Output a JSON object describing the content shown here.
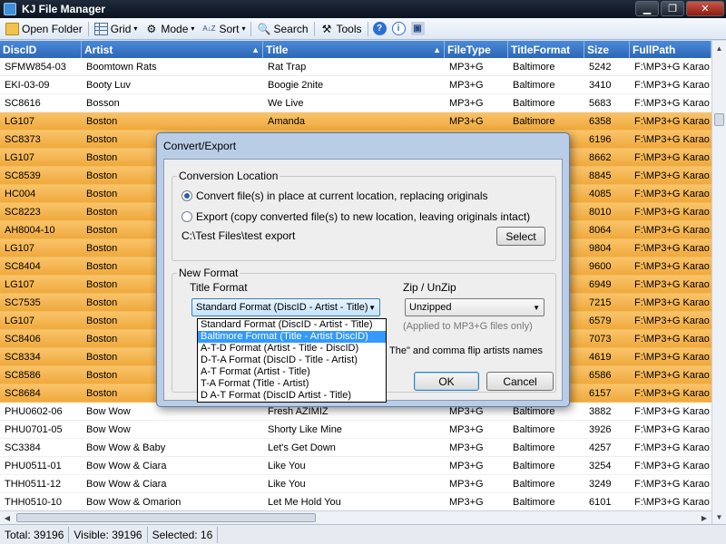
{
  "window": {
    "title": "KJ File Manager",
    "min": "▁",
    "max": "❐",
    "close": "✕"
  },
  "toolbar": {
    "open_folder": "Open Folder",
    "grid": "Grid",
    "mode": "Mode",
    "sort": "Sort",
    "search": "Search",
    "tools": "Tools",
    "help_glyph": "?",
    "info_glyph": "i",
    "sort_glyph": "A↓Z",
    "search_glyph": "🔍",
    "tools_glyph": "⚒",
    "caret": "▾"
  },
  "grid": {
    "columns": [
      "DiscID",
      "Artist",
      "Title",
      "FileType",
      "TitleFormat",
      "Size",
      "FullPath"
    ],
    "sort_arrow": "▲",
    "rows": [
      {
        "disc": "SFMW854-03",
        "artist": "Boomtown Rats",
        "title": "Rat Trap",
        "type": "MP3+G",
        "fmt": "Baltimore",
        "size": "5242",
        "path": "F:\\MP3+G Karao",
        "hl": false
      },
      {
        "disc": "EKI-03-09",
        "artist": "Booty Luv",
        "title": "Boogie 2nite",
        "type": "MP3+G",
        "fmt": "Baltimore",
        "size": "3410",
        "path": "F:\\MP3+G Karao",
        "hl": false
      },
      {
        "disc": "SC8616",
        "artist": "Bosson",
        "title": "We Live",
        "type": "MP3+G",
        "fmt": "Baltimore",
        "size": "5683",
        "path": "F:\\MP3+G Karao",
        "hl": false
      },
      {
        "disc": "LG107",
        "artist": "Boston",
        "title": "Amanda",
        "type": "MP3+G",
        "fmt": "Baltimore",
        "size": "6358",
        "path": "F:\\MP3+G Karao",
        "hl": true
      },
      {
        "disc": "SC8373",
        "artist": "Boston",
        "title": "",
        "type": "",
        "fmt": "",
        "size": "6196",
        "path": "F:\\MP3+G Karao",
        "hl": true
      },
      {
        "disc": "LG107",
        "artist": "Boston",
        "title": "",
        "type": "",
        "fmt": "",
        "size": "8662",
        "path": "F:\\MP3+G Karao",
        "hl": true
      },
      {
        "disc": "SC8539",
        "artist": "Boston",
        "title": "",
        "type": "",
        "fmt": "",
        "size": "8845",
        "path": "F:\\MP3+G Karao",
        "hl": true
      },
      {
        "disc": "HC004",
        "artist": "Boston",
        "title": "",
        "type": "",
        "fmt": "",
        "size": "4085",
        "path": "F:\\MP3+G Karao",
        "hl": true
      },
      {
        "disc": "SC8223",
        "artist": "Boston",
        "title": "",
        "type": "",
        "fmt": "",
        "size": "8010",
        "path": "F:\\MP3+G Karao",
        "hl": true
      },
      {
        "disc": "AH8004-10",
        "artist": "Boston",
        "title": "",
        "type": "",
        "fmt": "",
        "size": "8064",
        "path": "F:\\MP3+G Karao",
        "hl": true
      },
      {
        "disc": "LG107",
        "artist": "Boston",
        "title": "",
        "type": "",
        "fmt": "",
        "size": "9804",
        "path": "F:\\MP3+G Karao",
        "hl": true
      },
      {
        "disc": "SC8404",
        "artist": "Boston",
        "title": "",
        "type": "",
        "fmt": "",
        "size": "9600",
        "path": "F:\\MP3+G Karao",
        "hl": true
      },
      {
        "disc": "LG107",
        "artist": "Boston",
        "title": "",
        "type": "",
        "fmt": "",
        "size": "6949",
        "path": "F:\\MP3+G Karao",
        "hl": true
      },
      {
        "disc": "SC7535",
        "artist": "Boston",
        "title": "",
        "type": "",
        "fmt": "",
        "size": "7215",
        "path": "F:\\MP3+G Karao",
        "hl": true
      },
      {
        "disc": "LG107",
        "artist": "Boston",
        "title": "",
        "type": "",
        "fmt": "",
        "size": "6579",
        "path": "F:\\MP3+G Karao",
        "hl": true
      },
      {
        "disc": "SC8406",
        "artist": "Boston",
        "title": "",
        "type": "",
        "fmt": "",
        "size": "7073",
        "path": "F:\\MP3+G Karao",
        "hl": true
      },
      {
        "disc": "SC8334",
        "artist": "Boston",
        "title": "",
        "type": "",
        "fmt": "",
        "size": "4619",
        "path": "F:\\MP3+G Karao",
        "hl": true
      },
      {
        "disc": "SC8586",
        "artist": "Boston",
        "title": "",
        "type": "",
        "fmt": "",
        "size": "6586",
        "path": "F:\\MP3+G Karao",
        "hl": true
      },
      {
        "disc": "SC8684",
        "artist": "Boston",
        "title": "",
        "type": "",
        "fmt": "",
        "size": "6157",
        "path": "F:\\MP3+G Karao",
        "hl": true
      },
      {
        "disc": "PHU0602-06",
        "artist": "Bow Wow",
        "title": "Fresh AZIMIZ",
        "type": "MP3+G",
        "fmt": "Baltimore",
        "size": "3882",
        "path": "F:\\MP3+G Karao",
        "hl": false
      },
      {
        "disc": "PHU0701-05",
        "artist": "Bow Wow",
        "title": "Shorty Like Mine",
        "type": "MP3+G",
        "fmt": "Baltimore",
        "size": "3926",
        "path": "F:\\MP3+G Karao",
        "hl": false
      },
      {
        "disc": "SC3384",
        "artist": "Bow Wow & Baby",
        "title": "Let's Get Down",
        "type": "MP3+G",
        "fmt": "Baltimore",
        "size": "4257",
        "path": "F:\\MP3+G Karao",
        "hl": false
      },
      {
        "disc": "PHU0511-01",
        "artist": "Bow Wow & Ciara",
        "title": "Like You",
        "type": "MP3+G",
        "fmt": "Baltimore",
        "size": "3254",
        "path": "F:\\MP3+G Karao",
        "hl": false
      },
      {
        "disc": "THH0511-12",
        "artist": "Bow Wow & Ciara",
        "title": "Like You",
        "type": "MP3+G",
        "fmt": "Baltimore",
        "size": "3249",
        "path": "F:\\MP3+G Karao",
        "hl": false
      },
      {
        "disc": "THH0510-10",
        "artist": "Bow Wow & Omarion",
        "title": "Let Me Hold You",
        "type": "MP3+G",
        "fmt": "Baltimore",
        "size": "6101",
        "path": "F:\\MP3+G Karao",
        "hl": false
      }
    ]
  },
  "status": {
    "total": "Total: 39196",
    "visible": "Visible: 39196",
    "selected": "Selected: 16"
  },
  "dialog": {
    "title": "Convert/Export",
    "conversion_location": "Conversion Location",
    "option_in_place": "Convert file(s) in place at current location, replacing originals",
    "option_export": "Export (copy converted file(s) to new location, leaving originals intact)",
    "export_path": "C:\\Test Files\\test export",
    "select_button": "Select",
    "new_format": "New Format",
    "title_format_label": "Title Format",
    "title_format_value": "Standard Format (DiscID - Artist - Title)",
    "zip_label": "Zip / UnZip",
    "zip_value": "Unzipped",
    "zip_note": "(Applied to MP3+G files only)",
    "flip_note": "The\" and comma flip artists names",
    "ok_button": "OK",
    "cancel_button": "Cancel",
    "dropdown_options": [
      "Standard Format (DiscID - Artist - Title)",
      "Baltimore Format (Title - Artist DiscID)",
      "A-T-D Format (Artist - Title - DiscID)",
      "D-T-A Format (DiscID - Title - Artist)",
      "A-T Format (Artist - Title)",
      "T-A Format (Title - Artist)",
      "D A-T Format (DiscID Artist - Title)"
    ],
    "selected_option_index": 1
  },
  "colors": {
    "header": "#2d67b8",
    "highlight_row": "#f0a93c",
    "dialog_frame": "#b9cde6"
  }
}
